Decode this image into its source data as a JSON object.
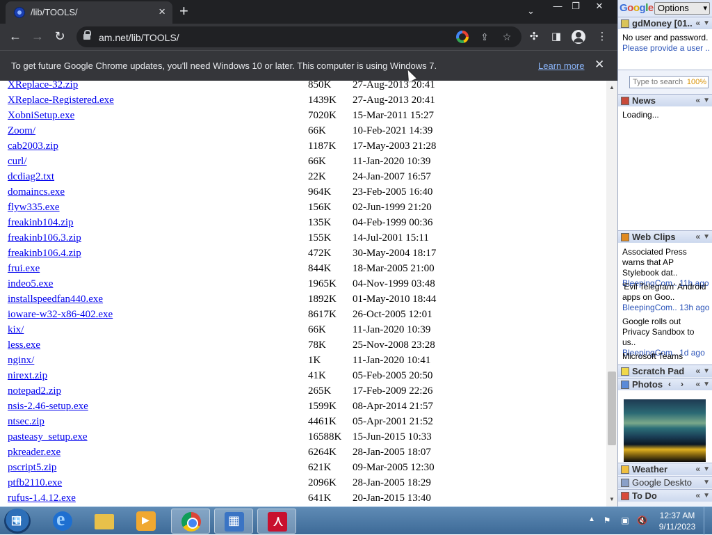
{
  "browser": {
    "tab_title": "/lib/TOOLS/",
    "new_tab": "+",
    "url": "am.net/lib/TOOLS/",
    "window_controls": {
      "minimize": "—",
      "restore": "❐",
      "close": "✕"
    },
    "infobar": {
      "message": "To get future Google Chrome updates, you'll need Windows 10 or later. This computer is using Windows 7.",
      "link": "Learn more",
      "close": "✕"
    }
  },
  "listing": [
    {
      "name": "XReplace-32.zip",
      "size": "850K",
      "date": "27-Aug-2013 20:41"
    },
    {
      "name": "XReplace-Registered.exe",
      "size": "1439K",
      "date": "27-Aug-2013 20:41"
    },
    {
      "name": "XobniSetup.exe",
      "size": "7020K",
      "date": "15-Mar-2011 15:27"
    },
    {
      "name": "Zoom/",
      "size": "66K",
      "date": "10-Feb-2021 14:39"
    },
    {
      "name": "cab2003.zip",
      "size": "1187K",
      "date": "17-May-2003 21:28"
    },
    {
      "name": "curl/",
      "size": "66K",
      "date": "11-Jan-2020 10:39"
    },
    {
      "name": "dcdiag2.txt",
      "size": "22K",
      "date": "24-Jan-2007 16:57"
    },
    {
      "name": "domaincs.exe",
      "size": "964K",
      "date": "23-Feb-2005 16:40"
    },
    {
      "name": "flyw335.exe",
      "size": "156K",
      "date": "02-Jun-1999 21:20"
    },
    {
      "name": "freakinb104.zip",
      "size": "135K",
      "date": "04-Feb-1999 00:36"
    },
    {
      "name": "freakinb106.3.zip",
      "size": "155K",
      "date": "14-Jul-2001 15:11"
    },
    {
      "name": "freakinb106.4.zip",
      "size": "472K",
      "date": "30-May-2004 18:17"
    },
    {
      "name": "frui.exe",
      "size": "844K",
      "date": "18-Mar-2005 21:00"
    },
    {
      "name": "indeo5.exe",
      "size": "1965K",
      "date": "04-Nov-1999 03:48"
    },
    {
      "name": "installspeedfan440.exe",
      "size": "1892K",
      "date": "01-May-2010 18:44"
    },
    {
      "name": "ioware-w32-x86-402.exe",
      "size": "8617K",
      "date": "26-Oct-2005 12:01"
    },
    {
      "name": "kix/",
      "size": "66K",
      "date": "11-Jan-2020 10:39"
    },
    {
      "name": "less.exe",
      "size": "78K",
      "date": "25-Nov-2008 23:28"
    },
    {
      "name": "nginx/",
      "size": "1K",
      "date": "11-Jan-2020 10:41"
    },
    {
      "name": "nirext.zip",
      "size": "41K",
      "date": "05-Feb-2005 20:50"
    },
    {
      "name": "notepad2.zip",
      "size": "265K",
      "date": "17-Feb-2009 22:26"
    },
    {
      "name": "nsis-2.46-setup.exe",
      "size": "1599K",
      "date": "08-Apr-2014 21:57"
    },
    {
      "name": "ntsec.zip",
      "size": "4461K",
      "date": "05-Apr-2001 21:52"
    },
    {
      "name": "pasteasy_setup.exe",
      "size": "16588K",
      "date": "15-Jun-2015 10:33"
    },
    {
      "name": "pkreader.exe",
      "size": "6264K",
      "date": "28-Jan-2005 18:07"
    },
    {
      "name": "pscript5.zip",
      "size": "621K",
      "date": "09-Mar-2005 12:30"
    },
    {
      "name": "ptfb2110.exe",
      "size": "2096K",
      "date": "28-Jan-2005 18:29"
    },
    {
      "name": "rufus-1.4.12.exe",
      "size": "641K",
      "date": "20-Jan-2015 13:40"
    }
  ],
  "sidebar": {
    "logo_letters": [
      "G",
      "o",
      "o",
      "g",
      "l",
      "e"
    ],
    "options_label": "Options",
    "gdmoney": {
      "title": "gdMoney [01..",
      "line1": "No user and password.",
      "line2": "Please provide a user .."
    },
    "search": {
      "placeholder": "Type to search",
      "zoom": "100%"
    },
    "news": {
      "title": "News",
      "body": "Loading..."
    },
    "webclips": {
      "title": "Web Clips",
      "items": [
        {
          "headline": "Associated Press warns that AP Stylebook dat..",
          "source": "BleepingCom..",
          "age": "11h ago"
        },
        {
          "headline": "'Evil Telegram' Android apps on Goo..",
          "source": "BleepingCom..",
          "age": "13h ago"
        },
        {
          "headline": "Google rolls out Privacy Sandbox to us..",
          "source": "BleepingCom..",
          "age": "1d ago"
        },
        {
          "headline": "Microsoft Teams",
          "source": "",
          "age": ""
        }
      ]
    },
    "scratchpad": {
      "title": "Scratch Pad"
    },
    "photos": {
      "title": "Photos"
    },
    "weather": {
      "title": "Weather"
    },
    "gdesktop": {
      "title": "Google Deskto"
    },
    "todo": {
      "title": "To Do"
    }
  },
  "taskbar": {
    "clock_time": "12:37 AM",
    "clock_date": "9/11/2023"
  },
  "colors": {
    "link": "#0000ee",
    "chrome_dark": "#202124",
    "chrome_toolbar": "#35363a"
  }
}
